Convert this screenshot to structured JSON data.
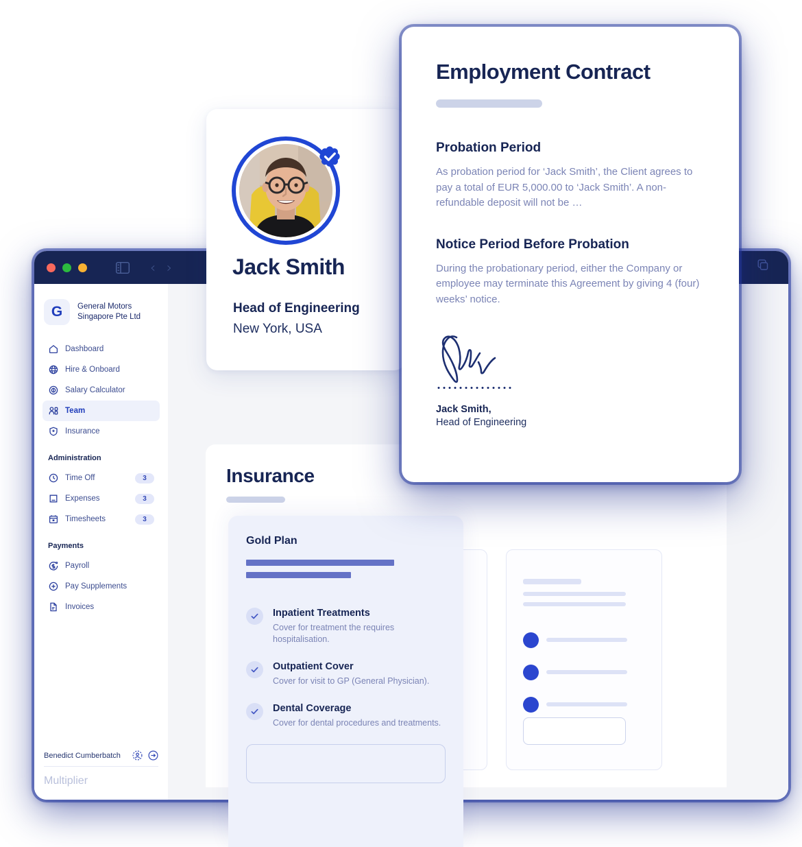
{
  "window": {
    "traffic_lights": [
      "close",
      "minimize",
      "maximize"
    ],
    "sidebar_toggle_icon": "sidebar-panel-icon",
    "nav_back_icon": "chevron-left-icon",
    "nav_forward_icon": "chevron-right-icon",
    "copy_icon": "copy-icon"
  },
  "sidebar": {
    "org": {
      "initial": "G",
      "line1": "General Motors",
      "line2": "Singapore Pte Ltd"
    },
    "items": [
      {
        "label": "Dashboard",
        "icon": "home-icon",
        "active": false,
        "badge": ""
      },
      {
        "label": "Hire & Onboard",
        "icon": "globe-icon",
        "active": false,
        "badge": ""
      },
      {
        "label": "Salary Calculator",
        "icon": "dollar-circle-icon",
        "active": false,
        "badge": ""
      },
      {
        "label": "Team",
        "icon": "people-icon",
        "active": true,
        "badge": ""
      },
      {
        "label": "Insurance",
        "icon": "shield-icon",
        "active": false,
        "badge": ""
      }
    ],
    "sections": [
      {
        "title": "Administration",
        "items": [
          {
            "label": "Time Off",
            "icon": "clock-icon",
            "badge": "3"
          },
          {
            "label": "Expenses",
            "icon": "receipt-icon",
            "badge": "3"
          },
          {
            "label": "Timesheets",
            "icon": "calendar-icon",
            "badge": "3"
          }
        ]
      },
      {
        "title": "Payments",
        "items": [
          {
            "label": "Payroll",
            "icon": "payroll-icon",
            "badge": ""
          },
          {
            "label": "Pay Supplements",
            "icon": "plus-circle-icon",
            "badge": ""
          },
          {
            "label": "Invoices",
            "icon": "document-icon",
            "badge": ""
          }
        ]
      }
    ],
    "footer": {
      "user_name": "Benedict Cumberbatch",
      "profile_icon": "user-dashed-circle-icon",
      "logout_icon": "arrow-right-circle-icon",
      "brand": "Multiplier"
    }
  },
  "insurance_page": {
    "title": "Insurance",
    "subtitle_placeholder": true
  },
  "profile_card": {
    "name": "Jack Smith",
    "role": "Head of Engineering",
    "location": "New York, USA",
    "verified_icon": "verified-badge-icon",
    "avatar": "employee-photo"
  },
  "gold_plan": {
    "title": "Gold Plan",
    "features": [
      {
        "name": "Inpatient Treatments",
        "description": "Cover for treatment the requires hospitalisation.",
        "check_icon": "check-icon"
      },
      {
        "name": "Outpatient Cover",
        "description": "Cover for visit to GP (General Physician).",
        "check_icon": "check-icon"
      },
      {
        "name": "Dental Coverage",
        "description": "Cover for dental procedures and treatments.",
        "check_icon": "check-icon"
      }
    ]
  },
  "contract": {
    "title": "Employment Contract",
    "sections": [
      {
        "heading": "Probation Period",
        "body": "As probation period for ‘Jack Smith’, the Client agrees to pay a total of EUR 5,000.00 to ‘Jack Smith’. A non-refundable deposit will not be …"
      },
      {
        "heading": "Notice Period Before Probation",
        "body": "During the probationary period, either the Company or employee may terminate this Agreement by giving 4 (four) weeks’ notice."
      }
    ],
    "signature": {
      "signature_icon": "handwritten-signature-icon",
      "name": "Jack Smith,",
      "role": "Head of Engineering"
    }
  },
  "colors": {
    "brand_navy": "#172554",
    "brand_blue": "#2046d4",
    "accent_light": "#eef1fb",
    "muted_text": "#7b84b5",
    "skeleton": "#dde2f6"
  }
}
